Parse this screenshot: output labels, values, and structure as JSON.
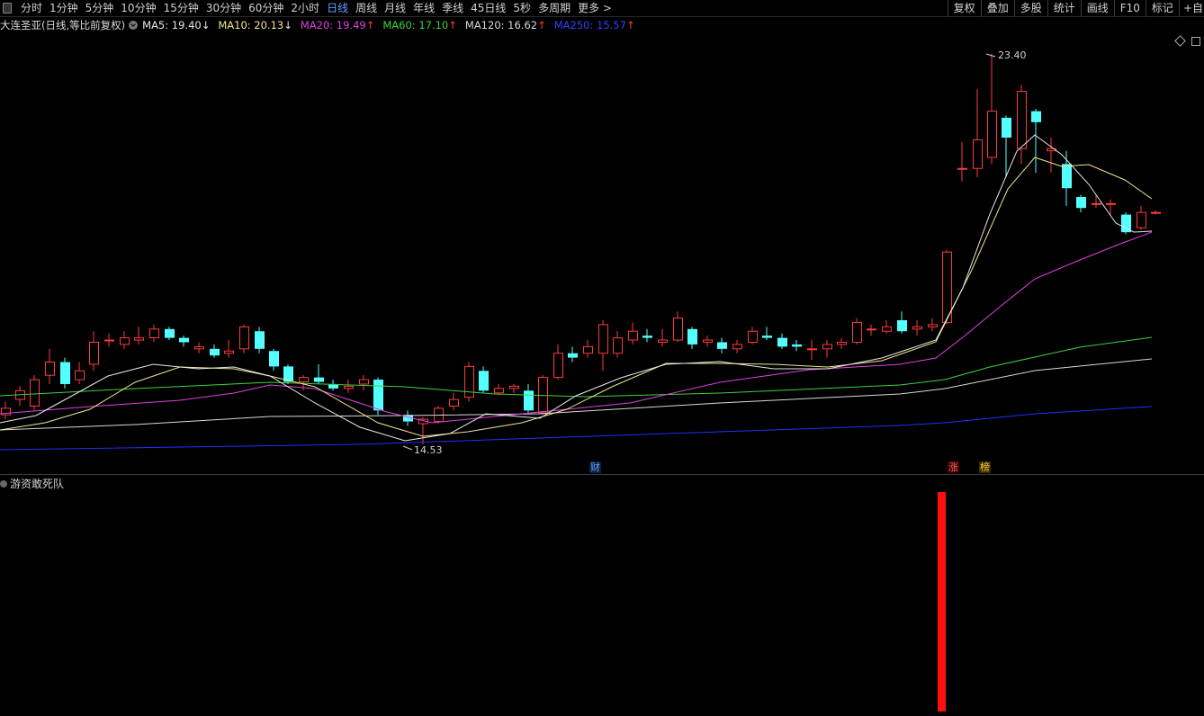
{
  "toolbar": {
    "periods": [
      "分时",
      "1分钟",
      "5分钟",
      "10分钟",
      "15分钟",
      "30分钟",
      "60分钟",
      "2小时",
      "日线",
      "周线",
      "月线",
      "年线",
      "季线",
      "45日线",
      "5秒",
      "多周期",
      "更多 >"
    ],
    "active_period": "日线",
    "right_buttons": [
      "复权",
      "叠加",
      "多股",
      "统计",
      "画线",
      "F10",
      "标记",
      "+自"
    ]
  },
  "info": {
    "stock_title": "大连圣亚(日线,等比前复权)",
    "ma": [
      {
        "label": "MA5: 19.40",
        "arrow": "↓",
        "color": "#e8e8e8",
        "arrow_color": "#e8e8e8"
      },
      {
        "label": "MA10: 20.13",
        "arrow": "↓",
        "color": "#f0e68c",
        "arrow_color": "#e8e8e8"
      },
      {
        "label": "MA20: 19.49",
        "arrow": "↑",
        "color": "#e040e0",
        "arrow_color": "#ff3a3a"
      },
      {
        "label": "MA60: 17.10",
        "arrow": "↑",
        "color": "#40d040",
        "arrow_color": "#ff3a3a"
      },
      {
        "label": "MA120: 16.62",
        "arrow": "↑",
        "color": "#d8d8d8",
        "arrow_color": "#ff3a3a"
      },
      {
        "label": "MA250: 15.57",
        "arrow": "↑",
        "color": "#3040ff",
        "arrow_color": "#ff3a3a"
      }
    ]
  },
  "chart": {
    "high_label": "23.40",
    "low_label": "14.53",
    "markers": {
      "cai": "财",
      "zhang": "涨",
      "bang": "榜"
    },
    "colors": {
      "up": "#ff3a3a",
      "down": "#54ffff",
      "ma5": "#e8e8e8",
      "ma10": "#f0e68c",
      "ma20": "#e040e0",
      "ma60": "#40d040",
      "ma120": "#d8d8d8",
      "ma250": "#2030ff"
    }
  },
  "indicator": {
    "title": "游资敢死队",
    "bar_color": "#ff1010"
  }
}
